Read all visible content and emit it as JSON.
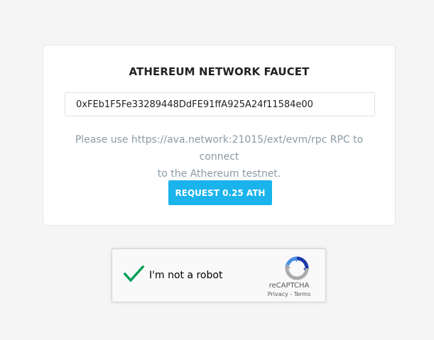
{
  "faucet": {
    "title": "ATHEREUM NETWORK FAUCET",
    "address_value": "0xFEb1F5Fe33289448DdFE91ffA925A24f11584e00",
    "hint_line1": "Please use https://ava.network:21015/ext/evm/rpc RPC to connect",
    "hint_line2": "to the Athereum testnet.",
    "request_button_label": "REQUEST 0.25 ATH",
    "accent_color": "#1ab3ec"
  },
  "recaptcha": {
    "checkbox_label": "I'm not a robot",
    "checked": true,
    "brand": "reCAPTCHA",
    "privacy_label": "Privacy",
    "separator": " - ",
    "terms_label": "Terms",
    "check_icon": "checkmark-icon",
    "logo_icon": "recaptcha-logo-icon"
  }
}
